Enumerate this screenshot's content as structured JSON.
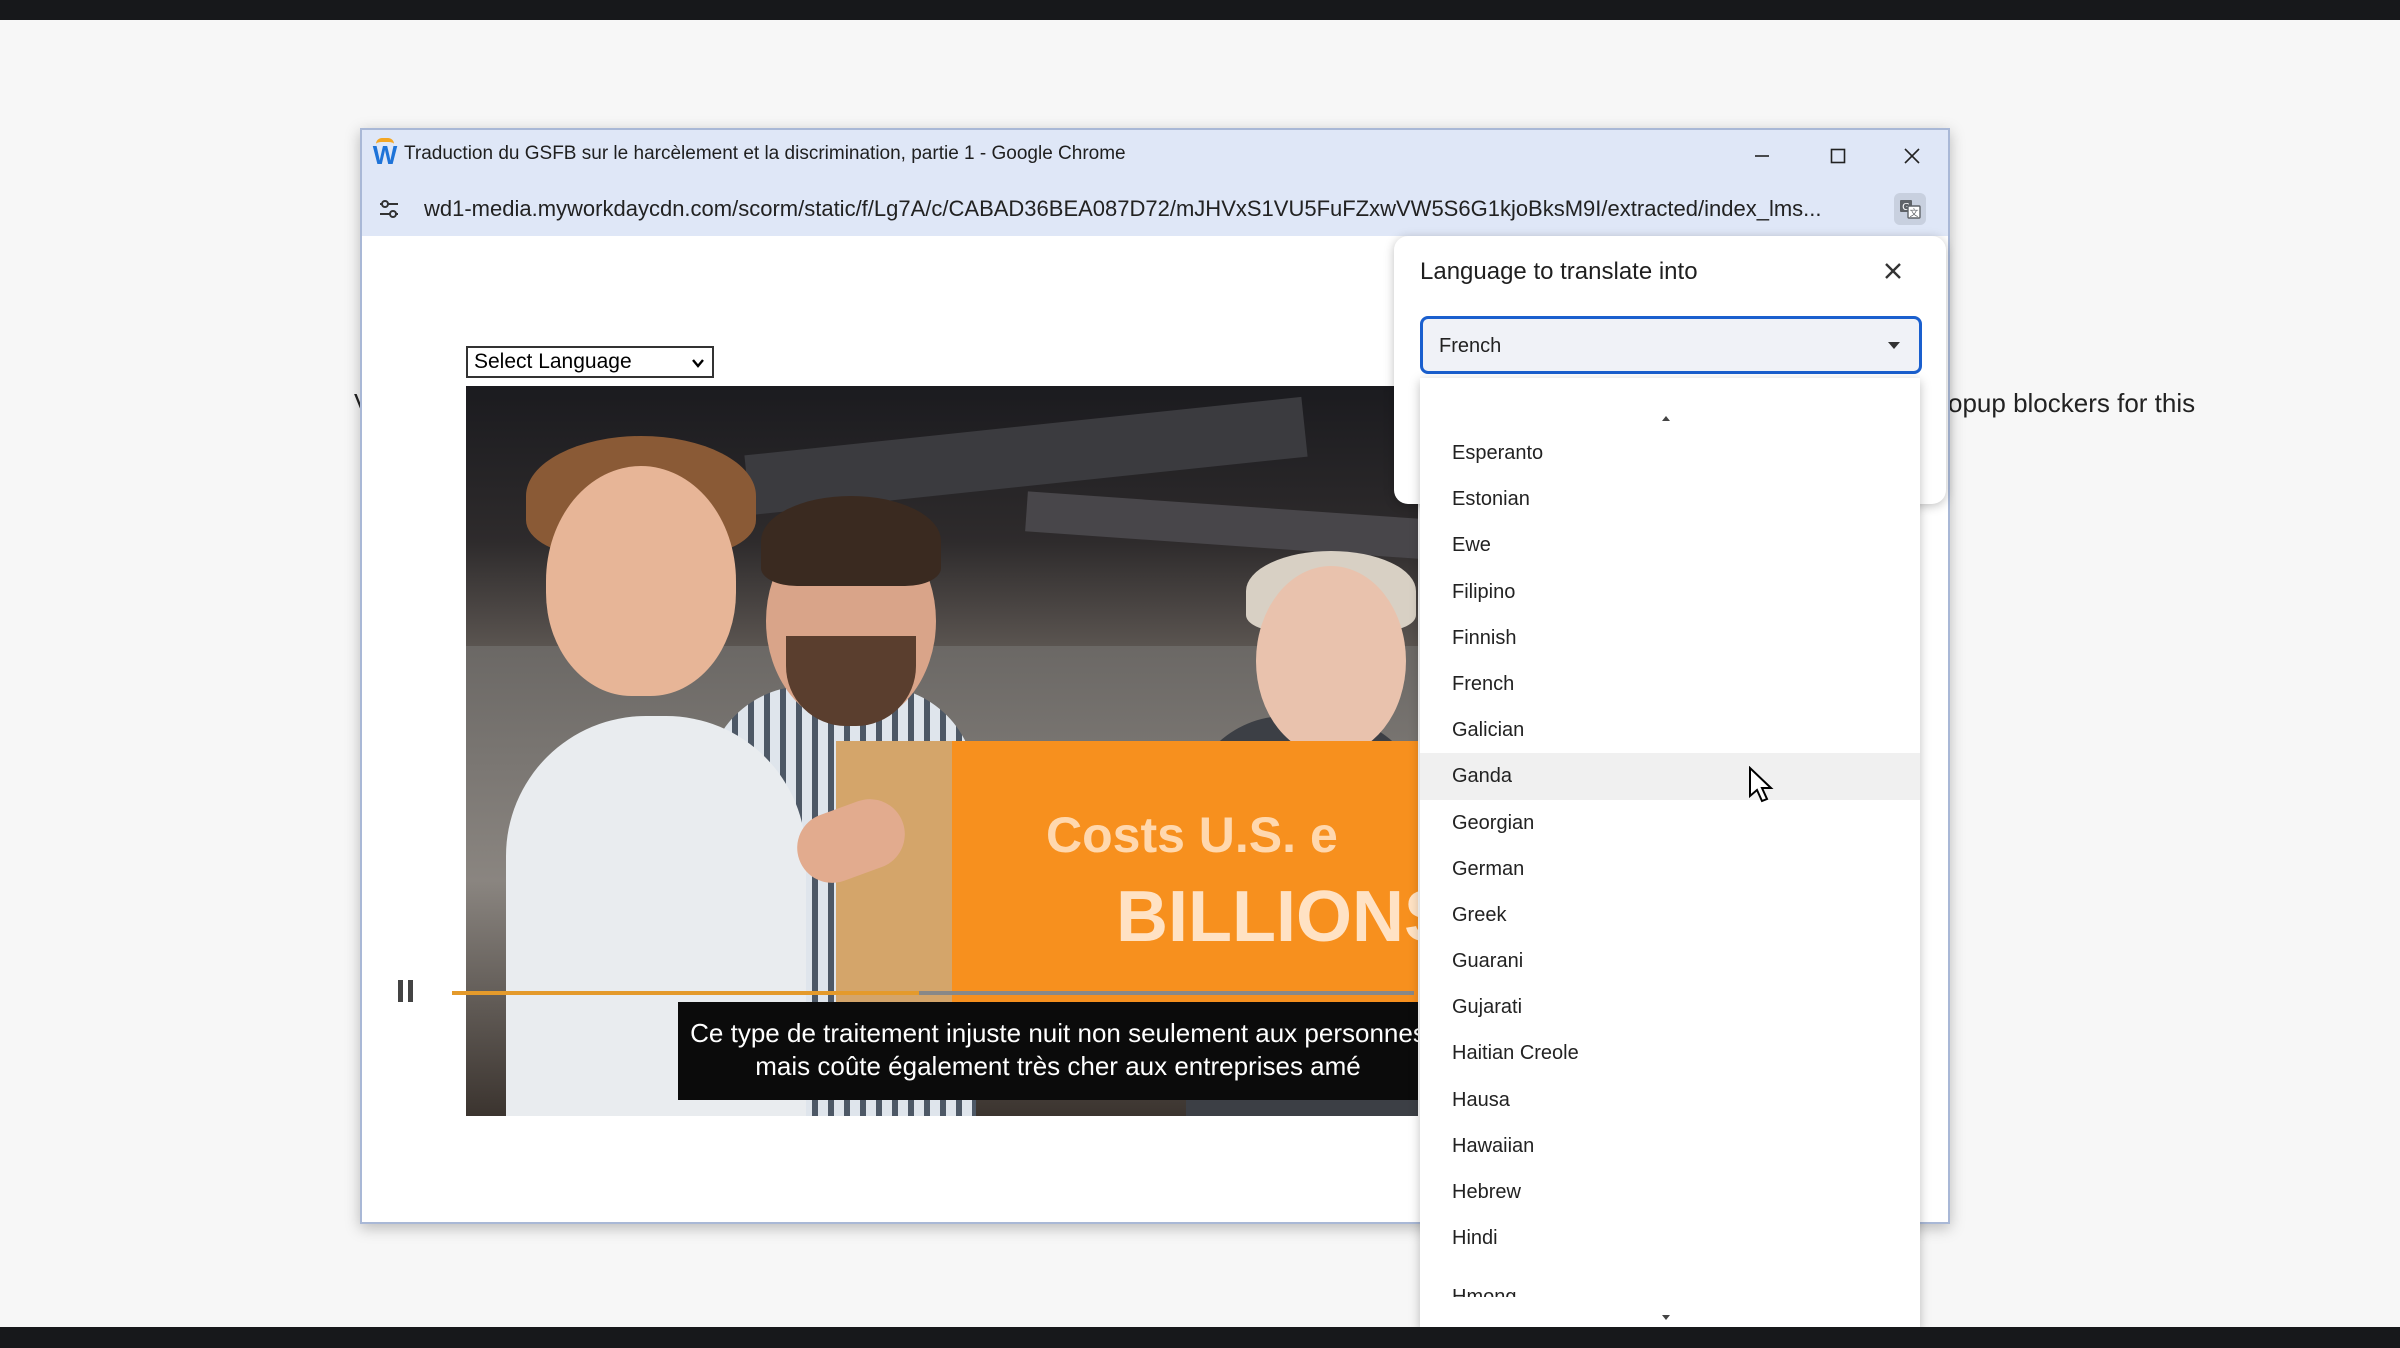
{
  "browser": {
    "title": "Traduction du GSFB sur le harcèlement et la discrimination, partie 1 - Google Chrome",
    "url": "wd1-media.myworkdaycdn.com/scorm/static/f/Lg7A/c/CABAD36BEA087D72/mJHVxS1VU5FuFZxwVW5S6G1kjoBksM9I/extracted/index_lms...",
    "app_logo_letter": "W",
    "app_logo_colors": [
      "#1e73d8",
      "#f4a623"
    ]
  },
  "page": {
    "select_language_label": "Select Language",
    "background_left_fragment": "V",
    "background_right_fragment": "opup blockers for this"
  },
  "video": {
    "box_text_line1": "Costs U.S. e",
    "box_text_line2": "BILLIONS",
    "subtitle_line1": "Ce type de traitement injuste nuit non seulement aux personnes",
    "subtitle_line2": "mais coûte également très cher aux entreprises amé",
    "progress_fraction": 0.485,
    "progress_color": "#e49a2b"
  },
  "translate_panel": {
    "title": "Language to translate into",
    "selected_language": "French",
    "accent_color": "#1a5fce"
  },
  "dropdown": {
    "items": [
      "Esperanto",
      "Estonian",
      "Ewe",
      "Filipino",
      "Finnish",
      "French",
      "Galician",
      "Ganda",
      "Georgian",
      "German",
      "Greek",
      "Guarani",
      "Gujarati",
      "Haitian Creole",
      "Hausa",
      "Hawaiian",
      "Hebrew",
      "Hindi"
    ],
    "partial_item": "Hmong",
    "hovered_item": "Ganda"
  }
}
